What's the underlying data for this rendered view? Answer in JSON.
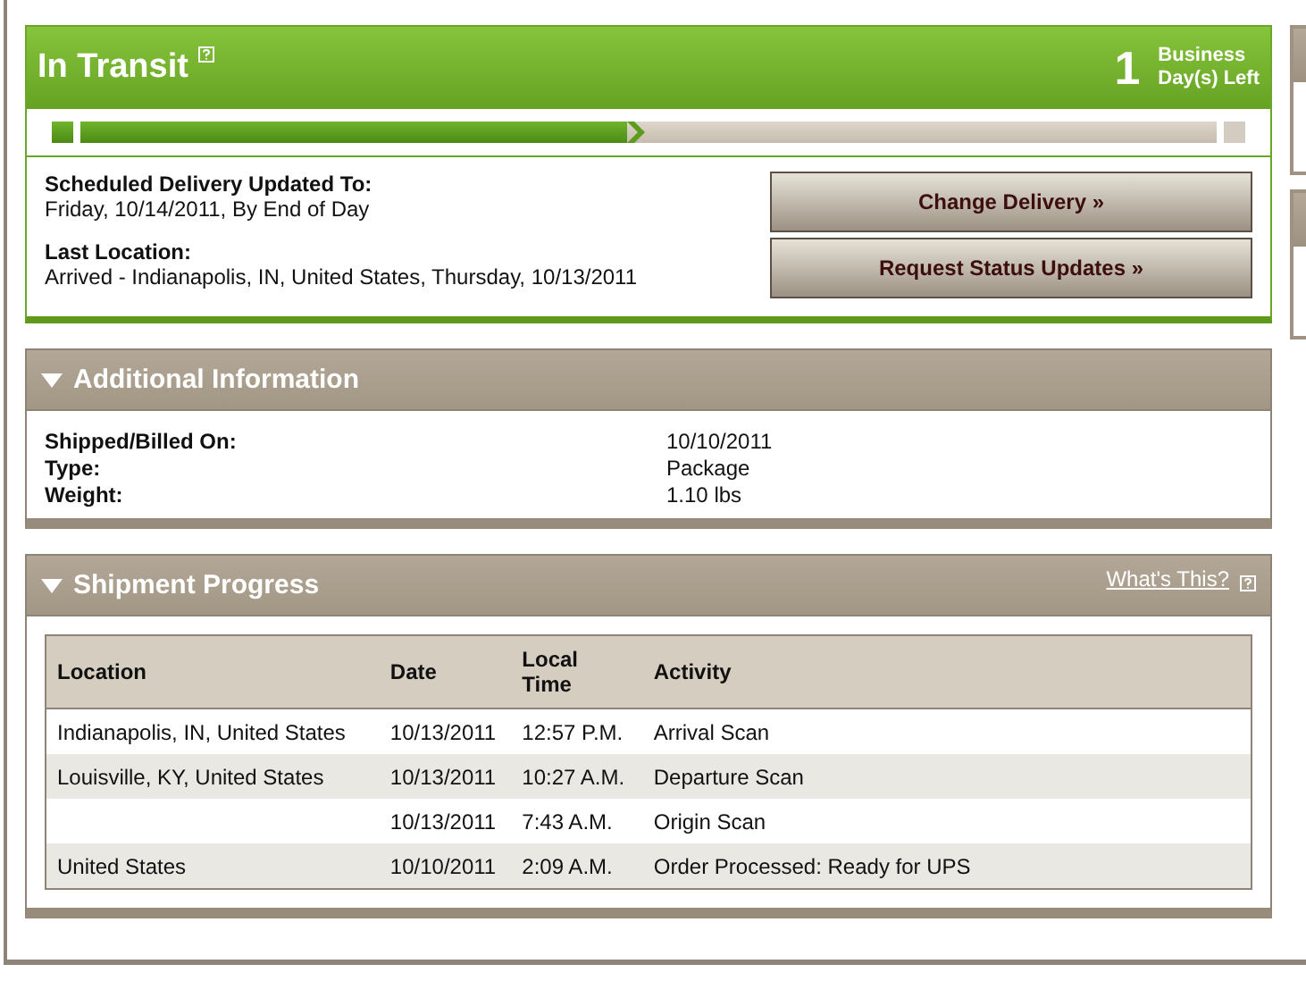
{
  "status": {
    "title": "In Transit",
    "days_left": "1",
    "days_label_lines": [
      "Business",
      "Day(s) Left"
    ]
  },
  "delivery": {
    "scheduled_label": "Scheduled Delivery Updated To:",
    "scheduled_value": "Friday, 10/14/2011, By End of Day",
    "location_label": "Last Location:",
    "location_value": "Arrived - Indianapolis, IN, United States, Thursday, 10/13/2011"
  },
  "buttons": [
    "Change Delivery »",
    "Request Status Updates »"
  ],
  "additional_info": {
    "title": "Additional Information",
    "expanded": true,
    "rows": [
      {
        "label": "Shipped/Billed On:",
        "value": "10/10/2011"
      },
      {
        "label": "Type:",
        "value": "Package"
      },
      {
        "label": "Weight:",
        "value": "1.10 lbs"
      }
    ]
  },
  "shipment_progress": {
    "title": "Shipment Progress",
    "expanded": true,
    "help_link": "What's This?",
    "columns": [
      "Location",
      "Date",
      "Local Time",
      "Activity"
    ],
    "rows": [
      {
        "location": "Indianapolis, IN, United States",
        "date": "10/13/2011",
        "time": "12:57 P.M.",
        "activity": "Arrival Scan"
      },
      {
        "location": "Louisville, KY, United States",
        "date": "10/13/2011",
        "time": "10:27 A.M.",
        "activity": "Departure Scan"
      },
      {
        "date": "10/13/2011",
        "time": "7:43 A.M.",
        "activity": "Origin Scan"
      },
      {
        "location": "United States",
        "date": "10/10/2011",
        "time": "2:09 A.M.",
        "activity": "Order Processed: Ready for UPS"
      }
    ]
  }
}
